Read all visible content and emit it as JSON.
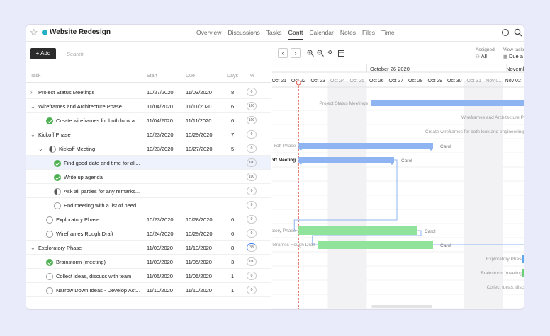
{
  "project": {
    "title": "Website Redesign",
    "dot_color": "#23b0c4"
  },
  "tabs": [
    {
      "label": "Overview"
    },
    {
      "label": "Discussions"
    },
    {
      "label": "Tasks"
    },
    {
      "label": "Gantt",
      "active": true
    },
    {
      "label": "Calendar"
    },
    {
      "label": "Notes"
    },
    {
      "label": "Files"
    },
    {
      "label": "Time"
    }
  ],
  "toolbar": {
    "add_label": "+ Add",
    "search_placeholder": "Search"
  },
  "columns": {
    "task": "Task",
    "start": "Start",
    "due": "Due",
    "days": "Days",
    "pct": "%"
  },
  "filters": {
    "assigned_label": "Assigned:",
    "assigned_value": "All",
    "view_label": "View tasks",
    "view_value": "Due a"
  },
  "tasks": [
    {
      "name": "Project Status Meetings",
      "start": "10/27/2020",
      "due": "11/03/2020",
      "days": "8",
      "pct": "0",
      "level": 0,
      "toggle": "collapsed",
      "status": "none"
    },
    {
      "name": "Wireframes and Architecture Phase",
      "start": "11/04/2020",
      "due": "11/11/2020",
      "days": "6",
      "pct": "100",
      "level": 0,
      "toggle": "expanded",
      "status": "none"
    },
    {
      "name": "Create wireframes for both look a...",
      "start": "11/04/2020",
      "due": "11/11/2020",
      "days": "6",
      "pct": "100",
      "level": 1,
      "toggle": "none",
      "status": "done"
    },
    {
      "name": "Kickoff Phase",
      "start": "10/23/2020",
      "due": "10/29/2020",
      "days": "7",
      "pct": "0",
      "level": 0,
      "toggle": "expanded",
      "status": "none"
    },
    {
      "name": "Kickoff Meeting",
      "start": "10/23/2020",
      "due": "10/27/2020",
      "days": "5",
      "pct": "0",
      "level": 1,
      "toggle": "expanded",
      "status": "half"
    },
    {
      "name": "Find good date and time for all...",
      "start": "",
      "due": "",
      "days": "",
      "pct": "100",
      "level": 2,
      "toggle": "none",
      "status": "done",
      "selected": true
    },
    {
      "name": "Write up agenda",
      "start": "",
      "due": "",
      "days": "",
      "pct": "100",
      "level": 2,
      "toggle": "none",
      "status": "done"
    },
    {
      "name": "Ask all parties for any remarks...",
      "start": "",
      "due": "",
      "days": "",
      "pct": "0",
      "level": 2,
      "toggle": "none",
      "status": "half"
    },
    {
      "name": "End meeting with a list of need...",
      "start": "",
      "due": "",
      "days": "",
      "pct": "0",
      "level": 2,
      "toggle": "none",
      "status": "open"
    },
    {
      "name": "Exploratory Phase",
      "start": "10/23/2020",
      "due": "10/28/2020",
      "days": "6",
      "pct": "0",
      "level": 1,
      "toggle": "none",
      "status": "open"
    },
    {
      "name": "Wireframes Rough Draft",
      "start": "10/24/2020",
      "due": "10/29/2020",
      "days": "6",
      "pct": "0",
      "level": 1,
      "toggle": "none",
      "status": "open"
    },
    {
      "name": "Exploratory Phase",
      "start": "11/03/2020",
      "due": "11/10/2020",
      "days": "8",
      "pct": "33",
      "level": 0,
      "toggle": "expanded",
      "status": "none"
    },
    {
      "name": "Brainstorm (meeting)",
      "start": "11/03/2020",
      "due": "11/05/2020",
      "days": "3",
      "pct": "100",
      "level": 1,
      "toggle": "none",
      "status": "done"
    },
    {
      "name": "Collect ideas, discuss with team",
      "start": "11/05/2020",
      "due": "11/05/2020",
      "days": "1",
      "pct": "0",
      "level": 1,
      "toggle": "none",
      "status": "open"
    },
    {
      "name": "Narrow Down Ideas - Develop Act...",
      "start": "11/10/2020",
      "due": "11/10/2020",
      "days": "1",
      "pct": "0",
      "level": 1,
      "toggle": "none",
      "status": "open"
    }
  ],
  "gantt": {
    "week_labels": [
      "October 26 2020",
      "Novemb"
    ],
    "days": [
      "Oct 21",
      "Oct 22",
      "Oct 23",
      "Oct 24",
      "Oct 25",
      "Oct 26",
      "Oct 27",
      "Oct 28",
      "Oct 29",
      "Oct 30",
      "Oct 31",
      "Nov 01",
      "Nov 02"
    ],
    "weekend_days": [
      "Oct 24",
      "Oct 25",
      "Oct 31",
      "Nov 01"
    ],
    "today": "Oct 22",
    "bar_colors": {
      "blue": "#8fb4f2",
      "green": "#90e39a",
      "link": "#8fb4f2",
      "today": "#e2574c"
    },
    "bars": [
      {
        "row": 0,
        "start": 5.2,
        "end": 14,
        "color": "blue",
        "label": "Project Status Meetings",
        "label_pos": "left"
      },
      {
        "row": 1,
        "label": "Wireframes and Architecture P",
        "label_pos": "right-edge"
      },
      {
        "row": 2,
        "label": "Create wireframes for both look and engineering",
        "label_pos": "right-edge"
      },
      {
        "row": 3,
        "start": 1.5,
        "end": 8.4,
        "color": "blue",
        "label": "koff Phase",
        "label_pos": "left",
        "assignee": "Carol"
      },
      {
        "row": 4,
        "start": 1.5,
        "end": 6.4,
        "color": "blue",
        "label": "koff Meeting",
        "label_pos": "left",
        "assignee": "Carol",
        "bold": true
      },
      {
        "row": 9,
        "start": 1.5,
        "end": 7.6,
        "color": "green",
        "label": "loratory Phase",
        "label_pos": "left",
        "assignee": "Carol"
      },
      {
        "row": 10,
        "start": 2.5,
        "end": 8.4,
        "color": "green",
        "label": "reframes Rough Draft",
        "label_pos": "left",
        "assignee": "Carol"
      },
      {
        "row": 11,
        "label": "Exploratory Phase",
        "label_pos": "right-edge"
      },
      {
        "row": 12,
        "label": "Brainstorm (meeting)",
        "label_pos": "right-edge"
      },
      {
        "row": 13,
        "label": "Collect ideas, disc",
        "label_pos": "right-edge"
      }
    ]
  }
}
